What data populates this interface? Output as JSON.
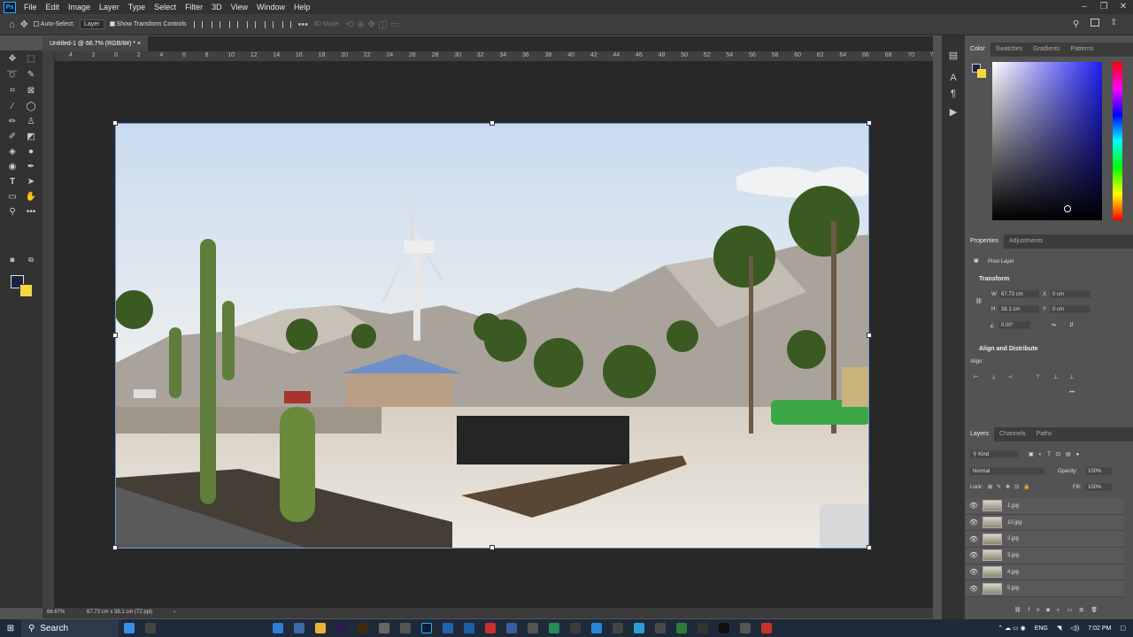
{
  "menubar": {
    "items": [
      "File",
      "Edit",
      "Image",
      "Layer",
      "Type",
      "Select",
      "Filter",
      "3D",
      "View",
      "Window",
      "Help"
    ],
    "controls": [
      "–",
      "❐",
      "✕"
    ]
  },
  "options": {
    "auto_select_label": "Auto-Select:",
    "auto_select_value": "Layer",
    "transform_controls_label": "Show Transform Controls",
    "mode_3d_label": "3D Mode:"
  },
  "document": {
    "tab_title": "Untitled-1 @ 66.7% (RGB/8#) *",
    "zoom": "66.67%",
    "doc_size": "67.73 cm x 38.1 cm (72 ppi)"
  },
  "ruler": {
    "ticks": [
      "4",
      "2",
      "0",
      "2",
      "4",
      "6",
      "8",
      "10",
      "12",
      "14",
      "16",
      "18",
      "20",
      "22",
      "24",
      "26",
      "28",
      "30",
      "32",
      "34",
      "36",
      "38",
      "40",
      "42",
      "44",
      "46",
      "48",
      "50",
      "52",
      "54",
      "56",
      "58",
      "60",
      "62",
      "64",
      "66",
      "68",
      "70",
      "72"
    ]
  },
  "color_panel": {
    "tabs": [
      "Color",
      "Swatches",
      "Gradients",
      "Patterns"
    ],
    "foreground": "#1b2440",
    "background": "#f7d843"
  },
  "properties": {
    "tabs": [
      "Properties",
      "Adjustments"
    ],
    "layer_type": "Pixel Layer",
    "transform_title": "Transform",
    "w_label": "W",
    "w_value": "67.73 cm",
    "h_label": "H",
    "h_value": "38.1 cm",
    "x_label": "X",
    "x_value": "0 cm",
    "y_label": "Y",
    "y_value": "0 cm",
    "angle_value": "0.00°",
    "align_title": "Align and Distribute",
    "align_label": "Align:"
  },
  "layers_panel": {
    "tabs": [
      "Layers",
      "Channels",
      "Paths"
    ],
    "filter_kind": "Kind",
    "blend_mode": "Normal",
    "opacity_label": "Opacity:",
    "opacity_value": "100%",
    "lock_label": "Lock:",
    "fill_label": "Fill:",
    "fill_value": "100%",
    "layers": [
      "1.jpg",
      "10.jpg",
      "2.jpg",
      "3.jpg",
      "4.jpg",
      "5.jpg"
    ]
  },
  "taskbar": {
    "search_label": "Search",
    "language": "ENG",
    "time": "7:02 PM"
  }
}
